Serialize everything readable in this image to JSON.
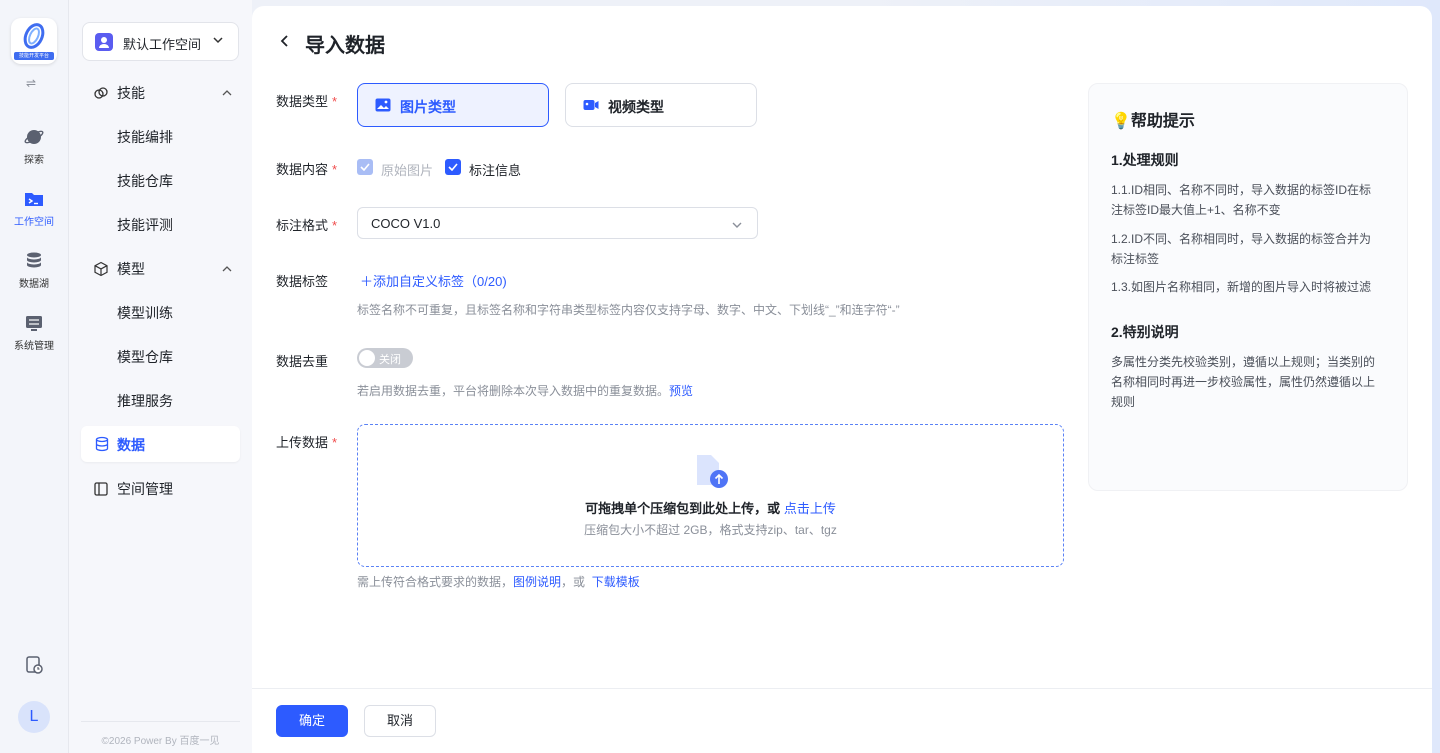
{
  "rail": {
    "logo_text": "技能开发平台",
    "items": [
      {
        "label": "探索",
        "icon": "planet-icon"
      },
      {
        "label": "工作空间",
        "icon": "terminal-folder-icon"
      },
      {
        "label": "数据湖",
        "icon": "database-icon"
      },
      {
        "label": "系统管理",
        "icon": "server-icon"
      }
    ],
    "avatar": "L"
  },
  "sidenav": {
    "workspace": "默认工作空间",
    "groups": [
      {
        "label": "技能",
        "items": [
          "技能编排",
          "技能仓库",
          "技能评测"
        ]
      },
      {
        "label": "模型",
        "items": [
          "模型训练",
          "模型仓库",
          "推理服务"
        ]
      }
    ],
    "active": "数据",
    "space": "空间管理",
    "copyright": "©2026 Power By 百度一见"
  },
  "page": {
    "title": "导入数据",
    "fields": {
      "data_type": "数据类型",
      "data_content": "数据内容",
      "label_format": "标注格式",
      "data_tags": "数据标签",
      "dedup": "数据去重",
      "upload": "上传数据"
    },
    "required_mark": "*",
    "type_options": {
      "image": "图片类型",
      "video": "视频类型",
      "selected": "图片类型"
    },
    "content_options": {
      "raw": "原始图片",
      "annot": "标注信息"
    },
    "format_value": "COCO V1.0",
    "add_tag": "添加自定义标签（0/20)",
    "tag_hint": "标签名称不可重复，且标签名称和字符串类型标签内容仅支持字母、数字、中文、下划线“_”和连字符“-”",
    "toggle_label": "关闭",
    "dedup_hint": "若启用数据去重，平台将删除本次导入数据中的重复数据。",
    "dedup_link": "预览",
    "upload_text": "可拖拽单个压缩包到此处上传，或",
    "upload_link": "点击上传",
    "upload_limit": "压缩包大小不超过 2GB，格式支持zip、tar、tgz",
    "upload_hint_prefix": "需上传符合格式要求的数据，",
    "upload_hint_link1": "图例说明",
    "upload_hint_mid": "，或",
    "upload_hint_link2": "下载模板"
  },
  "help": {
    "title": "💡帮助提示",
    "section1": "1.处理规则",
    "rules": [
      "1.1.ID相同、名称不同时，导入数据的标签ID在标注标签ID最大值上+1、名称不变",
      "1.2.ID不同、名称相同时，导入数据的标签合并为标注标签",
      "1.3.如图片名称相同，新增的图片导入时将被过滤"
    ],
    "section2": "2.特别说明",
    "note": "多属性分类先校验类别，遵循以上规则；当类别的名称相同时再进一步校验属性，属性仍然遵循以上规则"
  },
  "actions": {
    "confirm": "确定",
    "cancel": "取消"
  },
  "colors": {
    "accent": "#2d5bff",
    "required": "#f04c4c"
  }
}
